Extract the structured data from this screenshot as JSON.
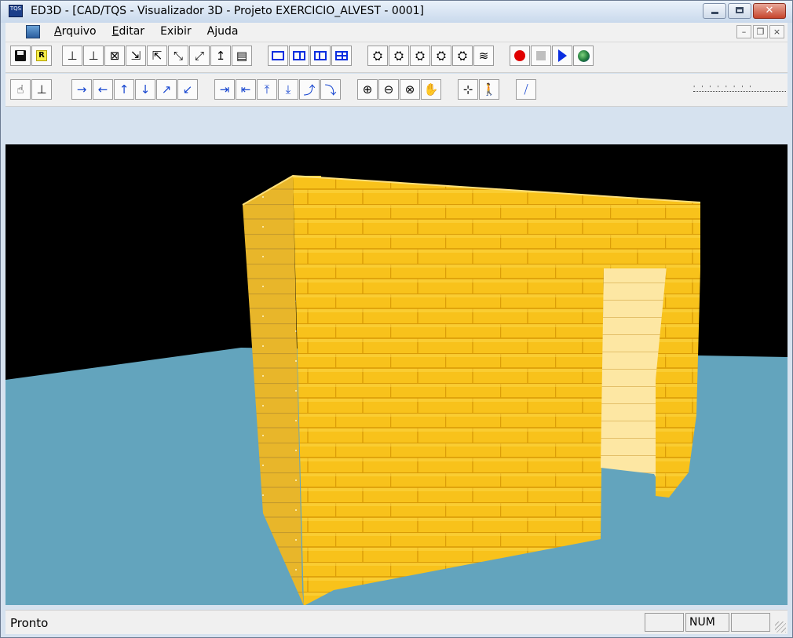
{
  "window": {
    "title": "ED3D - [CAD/TQS - Visualizador 3D - Projeto EXERCICIO_ALVEST - 0001]",
    "app_icon_text": "TQS"
  },
  "menu": {
    "items": [
      {
        "label_u": "A",
        "label_rest": "rquivo"
      },
      {
        "label_u": "E",
        "label_rest": "ditar"
      },
      {
        "label_u": "",
        "label_rest": "Exibir"
      },
      {
        "label_u": "",
        "label_rest": "Ajuda"
      }
    ]
  },
  "toolbar1": {
    "r_badge": "R"
  },
  "toolbar2": {
    "arrow_right": "→",
    "arrow_left": "←",
    "arrow_up": "↑",
    "arrow_down": "↓"
  },
  "statusbar": {
    "status": "Pronto",
    "num_indicator": "NUM"
  },
  "colors": {
    "sky": "#000000",
    "floor": "#63a4bd",
    "brick": "#f7c21a",
    "brick_light": "#fde58a",
    "mortar": "#d49a08"
  }
}
